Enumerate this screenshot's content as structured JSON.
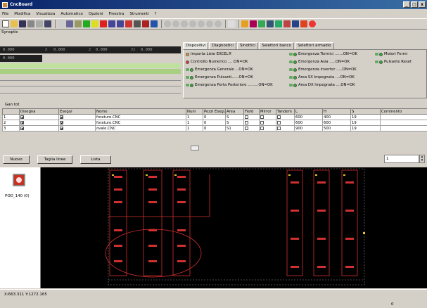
{
  "window": {
    "title": "CncBoard"
  },
  "menu": [
    "File",
    "Modifica",
    "Visualizza",
    "Automatico",
    "Opzioni",
    "Finestra",
    "Strumenti",
    "?"
  ],
  "synoptic_label": "Synoptic",
  "readout": {
    "x": "0.000",
    "y": "0.000",
    "z": "0.000",
    "v2": "0.000",
    "v3": "0.000",
    "x_label": "X",
    "z_label": "Z",
    "v2_label": "V2"
  },
  "tabs": [
    "Dispositivi",
    "Diagnostici",
    "Sinottici",
    "Selettori banco",
    "Selettori armadio"
  ],
  "diagnostics": {
    "col1": [
      "Importa Liste EXCEL®",
      "Controllo Numerico .....ON=OK",
      "Emergenza Generale ...ON=OK",
      "Emergenza Pulsanti......ON=OK",
      "Emergenza Porta Posteriore .........ON=OK"
    ],
    "col2": [
      "Emergenza Termici .......ON=OK",
      "Emergenza Asia .....ON=OK",
      "Emergenza inverter .....ON=OK",
      "Area SX Impegnata ....ON=OK",
      "Area DX Impegnata ....ON=OK"
    ],
    "col3": [
      "Motori Fermi",
      "Pulsante Reset"
    ]
  },
  "grid_label": "Gan tot",
  "table": {
    "headers": [
      "",
      "Disegna",
      "Esegui",
      "Nome",
      "Num",
      "Pezzi Esegu",
      "Area",
      "Field",
      "Mirror",
      "Tandem",
      "L",
      "H",
      "S",
      "Commento"
    ],
    "rows": [
      {
        "n": "1",
        "draw": true,
        "exec": true,
        "name": "forature.CNC",
        "num": "1",
        "pezzi": "0",
        "area": "S",
        "l": "600",
        "h": "400",
        "s": "19",
        "comment": ""
      },
      {
        "n": "2",
        "draw": true,
        "exec": true,
        "name": "forature.CNC",
        "num": "1",
        "pezzi": "0",
        "area": "S",
        "l": "600",
        "h": "600",
        "s": "19",
        "comment": ""
      },
      {
        "n": "3",
        "draw": true,
        "exec": true,
        "name": "ovale.CNC",
        "num": "1",
        "pezzi": "0",
        "area": "S1",
        "l": "900",
        "h": "500",
        "s": "19",
        "comment": ""
      }
    ]
  },
  "buttons": {
    "nuovo": "Nuovo",
    "taglia": "Taglia linee",
    "lista": "Lista"
  },
  "page_field": "1",
  "pod": {
    "label": "POD_140",
    "count": "(0)"
  },
  "status": {
    "coords": "X:663.311 Y:1272.165",
    "page": "0"
  },
  "colors": {
    "titlebar": "#0a246a",
    "canvas_bg": "#000000",
    "panel": "#d4d0c8",
    "drawing_red": "#d03030"
  }
}
